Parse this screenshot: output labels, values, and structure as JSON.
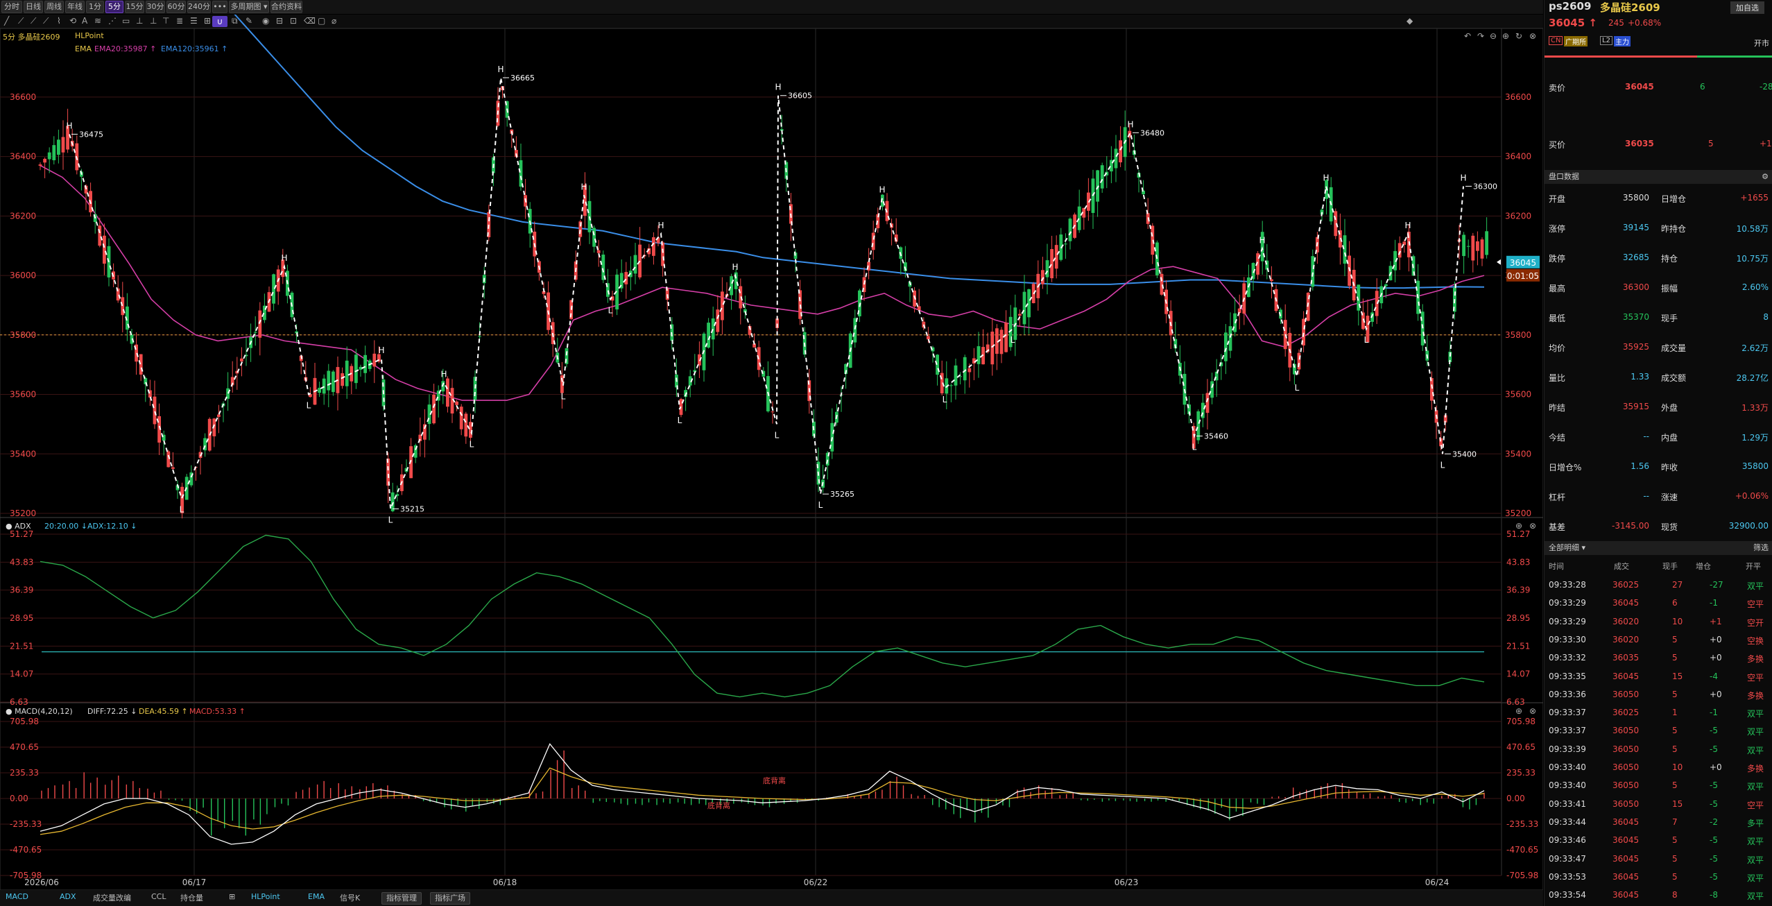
{
  "toolbar": {
    "timeframes": [
      "分时",
      "日线",
      "周线",
      "年线",
      "1分",
      "5分",
      "15分",
      "30分",
      "60分",
      "240分",
      "•••",
      "多周期图 ▾",
      "合约资料"
    ],
    "active_timeframe": "5分"
  },
  "chart_header": {
    "period_symbol": "5分 多晶硅2609",
    "indicator": "HLPoint",
    "ema_label": "EMA",
    "ema20": "EMA20:35987 ↑",
    "ema120": "EMA120:35961 ↑"
  },
  "adx_header": {
    "name": "ADX",
    "v1": "20:20.00 ↓",
    "v2": "ADX:12.10 ↓"
  },
  "macd_header": {
    "name": "MACD(4,20,12)",
    "diff": "DIFF:72.25 ↓",
    "dea": "DEA:45.59 ↑",
    "macd": "MACD:53.33 ↑"
  },
  "colors": {
    "up": "#f04a4a",
    "down": "#25c25a",
    "ema20": "#d63fa8",
    "ema120": "#3a8ee8",
    "adx": "#2aa84a",
    "diff": "#ffffff",
    "dea": "#e8b830",
    "zigzag": "#ffffff"
  },
  "chart_data": [
    {
      "type": "candlestick",
      "title": "多晶硅2609 5分",
      "x_labels": [
        "2026/06",
        "06/17",
        "06/18",
        "06/22",
        "06/23",
        "06/24"
      ],
      "ylim": [
        35200,
        36700
      ],
      "y_ticks": [
        35200,
        35400,
        35600,
        35800,
        36000,
        36200,
        36400,
        36600
      ],
      "reference_line": 35800,
      "current_price": "36045",
      "countdown": "0:01:05",
      "ema20": [
        36370,
        36330,
        36260,
        36150,
        36040,
        35920,
        35850,
        35800,
        35780,
        35790,
        35800,
        35780,
        35770,
        35760,
        35750,
        35700,
        35650,
        35620,
        35600,
        35580,
        35580,
        35580,
        35600,
        35700,
        35850,
        35880,
        35900,
        35930,
        35960,
        35950,
        35940,
        35920,
        35900,
        35890,
        35880,
        35870,
        35890,
        35920,
        35940,
        35900,
        35870,
        35860,
        35880,
        35850,
        35830,
        35820,
        35850,
        35880,
        35920,
        35980,
        36020,
        36030,
        36010,
        35990,
        35900,
        35780,
        35760,
        35800,
        35860,
        35900,
        35920,
        35940,
        35930,
        35950,
        35980,
        36000
      ],
      "ema120": [
        36900,
        36800,
        36700,
        36600,
        36500,
        36420,
        36360,
        36300,
        36250,
        36220,
        36200,
        36180,
        36170,
        36160,
        36150,
        36130,
        36110,
        36100,
        36090,
        36080,
        36060,
        36050,
        36040,
        36030,
        36020,
        36010,
        36000,
        35990,
        35985,
        35980,
        35975,
        35970,
        35970,
        35970,
        35975,
        35980,
        35985,
        35985,
        35980,
        35975,
        35970,
        35965,
        35960,
        35958,
        35958,
        35960,
        35962,
        35961
      ],
      "hl_points": [
        {
          "t": "H",
          "v": 36475,
          "label": "36475"
        },
        {
          "t": "L",
          "v": 35250
        },
        {
          "t": "H",
          "v": 36030
        },
        {
          "t": "L",
          "v": 35600
        },
        {
          "t": "H",
          "v": 35720
        },
        {
          "t": "L",
          "v": 35215,
          "label": "35215"
        },
        {
          "t": "H",
          "v": 35640
        },
        {
          "t": "L",
          "v": 35470
        },
        {
          "t": "H",
          "v": 36665,
          "label": "36665"
        },
        {
          "t": "L",
          "v": 35630
        },
        {
          "t": "H",
          "v": 36270
        },
        {
          "t": "L",
          "v": 35920
        },
        {
          "t": "H",
          "v": 36140
        },
        {
          "t": "L",
          "v": 35550
        },
        {
          "t": "H",
          "v": 36000
        },
        {
          "t": "L",
          "v": 35500
        },
        {
          "t": "H",
          "v": 36605,
          "label": "36605"
        },
        {
          "t": "L",
          "v": 35265,
          "label": "35265"
        },
        {
          "t": "H",
          "v": 36260
        },
        {
          "t": "L",
          "v": 35620
        },
        {
          "t": "L",
          "v": 35820
        },
        {
          "t": "H",
          "v": 36480,
          "label": "36480"
        },
        {
          "t": "L",
          "v": 35460,
          "label": "35460"
        },
        {
          "t": "H",
          "v": 36090
        },
        {
          "t": "L",
          "v": 35660
        },
        {
          "t": "H",
          "v": 36300
        },
        {
          "t": "L",
          "v": 35820
        },
        {
          "t": "H",
          "v": 36140
        },
        {
          "t": "L",
          "v": 35400,
          "label": "35400"
        },
        {
          "t": "H",
          "v": 36300,
          "label": "36300"
        }
      ]
    },
    {
      "type": "line",
      "title": "ADX",
      "ylim": [
        6.63,
        51.27
      ],
      "y_ticks": [
        51.27,
        43.83,
        36.39,
        28.95,
        21.51,
        14.07,
        6.63
      ],
      "reference_value": 20,
      "adx": [
        44,
        43,
        40,
        36,
        32,
        29,
        31,
        36,
        42,
        48,
        51,
        50,
        44,
        34,
        26,
        22,
        21,
        19,
        22,
        27,
        34,
        38,
        41,
        40,
        38,
        35,
        32,
        29,
        22,
        14,
        9,
        8,
        9,
        8,
        9,
        11,
        16,
        20,
        21,
        19,
        17,
        16,
        17,
        18,
        19,
        22,
        26,
        27,
        24,
        22,
        21,
        22,
        22,
        24,
        23,
        20,
        17,
        15,
        14,
        13,
        12,
        11,
        11,
        13,
        12
      ]
    },
    {
      "type": "line+bar",
      "title": "MACD(4,20,12)",
      "ylim": [
        -705.98,
        705.98
      ],
      "y_ticks": [
        705.98,
        470.65,
        235.33,
        0,
        -235.33,
        -470.65,
        -705.98
      ],
      "annotations": [
        "底背离",
        "底背离"
      ],
      "diff": [
        -300,
        -250,
        -150,
        -50,
        0,
        0,
        -50,
        -150,
        -350,
        -420,
        -400,
        -300,
        -150,
        -50,
        0,
        50,
        80,
        50,
        0,
        -50,
        -80,
        -50,
        0,
        50,
        500,
        260,
        120,
        80,
        60,
        40,
        20,
        0,
        -10,
        -20,
        -40,
        -30,
        -20,
        0,
        30,
        80,
        250,
        160,
        40,
        -60,
        -120,
        -60,
        60,
        100,
        80,
        40,
        30,
        20,
        10,
        0,
        -50,
        -100,
        -180,
        -120,
        -60,
        20,
        80,
        120,
        90,
        80,
        30,
        0,
        60,
        -30,
        72
      ],
      "dea": [
        -330,
        -300,
        -230,
        -150,
        -80,
        -40,
        -40,
        -80,
        -180,
        -250,
        -280,
        -260,
        -200,
        -130,
        -70,
        -20,
        20,
        30,
        20,
        0,
        -20,
        -20,
        -10,
        10,
        280,
        200,
        140,
        110,
        90,
        70,
        50,
        30,
        20,
        10,
        0,
        -5,
        -10,
        -5,
        10,
        40,
        150,
        140,
        90,
        30,
        -10,
        -20,
        10,
        40,
        55,
        50,
        45,
        35,
        25,
        15,
        0,
        -30,
        -80,
        -90,
        -70,
        -30,
        10,
        50,
        60,
        65,
        50,
        30,
        40,
        20,
        46
      ],
      "macd": [
        120,
        160,
        240,
        210,
        160,
        90,
        -20,
        -140,
        -340,
        -340,
        -240,
        -80,
        100,
        160,
        140,
        140,
        120,
        40,
        -40,
        -100,
        -120,
        -60,
        20,
        80,
        440,
        120,
        -40,
        -60,
        -60,
        -60,
        -60,
        -60,
        -60,
        -60,
        -80,
        -50,
        -20,
        10,
        40,
        80,
        200,
        40,
        -100,
        -180,
        -220,
        -80,
        100,
        120,
        50,
        -20,
        -30,
        -30,
        -30,
        -30,
        -100,
        -140,
        -200,
        -60,
        20,
        100,
        140,
        140,
        60,
        30,
        -40,
        -60,
        40,
        -100,
        53
      ]
    }
  ],
  "bottom_tabs": [
    "MACD",
    "ADX",
    "成交量改编",
    "CCL",
    "持仓量",
    "HLPoint",
    "EMA",
    "信号K"
  ],
  "bottom_buttons": [
    "指标管理",
    "指标广场"
  ],
  "panel": {
    "symbol": "ps2609",
    "name": "多晶硅2609",
    "add_btn": "加自选",
    "price": "36045 ↑",
    "change": "245",
    "pct": "+0.68%",
    "tags": [
      "CN",
      "广期所",
      "L2",
      "主力"
    ],
    "open_label": "开市",
    "ask_label": "卖价",
    "ask": "36045",
    "ask_vol": "6",
    "ask_chg": "-28",
    "bid_label": "买价",
    "bid": "36035",
    "bid_vol": "5",
    "bid_chg": "+1",
    "section_title": "盘口数据",
    "rows": [
      [
        "开盘",
        "35800",
        "日增仓",
        "+1655"
      ],
      [
        "涨停",
        "39145",
        "昨持仓",
        "10.58万"
      ],
      [
        "跌停",
        "32685",
        "持仓",
        "10.75万"
      ],
      [
        "最高",
        "36300",
        "振幅",
        "2.60%"
      ],
      [
        "最低",
        "35370",
        "现手",
        "8"
      ],
      [
        "均价",
        "35925",
        "成交量",
        "2.62万"
      ],
      [
        "量比",
        "1.33",
        "成交额",
        "28.27亿"
      ],
      [
        "昨结",
        "35915",
        "外盘",
        "1.33万"
      ],
      [
        "今结",
        "--",
        "内盘",
        "1.29万"
      ],
      [
        "日增仓%",
        "1.56",
        "昨收",
        "35800"
      ],
      [
        "杠杆",
        "--",
        "涨速",
        "+0.06%"
      ],
      [
        "基差",
        "-3145.00",
        "现货",
        "32900.00"
      ]
    ],
    "trades_title": "全部明细 ▾",
    "filter": "筛选",
    "trade_headers": [
      "时间",
      "成交",
      "现手",
      "增仓",
      "开平"
    ],
    "trades": [
      [
        "09:33:28",
        "36025",
        "27",
        "-27",
        "双平"
      ],
      [
        "09:33:29",
        "36045",
        "6",
        "-1",
        "空平"
      ],
      [
        "09:33:29",
        "36020",
        "10",
        "+1",
        "空开"
      ],
      [
        "09:33:30",
        "36020",
        "5",
        "+0",
        "空换"
      ],
      [
        "09:33:32",
        "36035",
        "5",
        "+0",
        "多换"
      ],
      [
        "09:33:35",
        "36045",
        "15",
        "-4",
        "空平"
      ],
      [
        "09:33:36",
        "36050",
        "5",
        "+0",
        "多换"
      ],
      [
        "09:33:37",
        "36025",
        "1",
        "-1",
        "双平"
      ],
      [
        "09:33:37",
        "36050",
        "5",
        "-5",
        "双平"
      ],
      [
        "09:33:39",
        "36050",
        "5",
        "-5",
        "双平"
      ],
      [
        "09:33:40",
        "36050",
        "10",
        "+0",
        "多换"
      ],
      [
        "09:33:40",
        "36050",
        "5",
        "-5",
        "双平"
      ],
      [
        "09:33:41",
        "36050",
        "15",
        "-5",
        "空平"
      ],
      [
        "09:33:44",
        "36045",
        "7",
        "-2",
        "多平"
      ],
      [
        "09:33:46",
        "36045",
        "5",
        "-5",
        "双平"
      ],
      [
        "09:33:47",
        "36045",
        "5",
        "-5",
        "双平"
      ],
      [
        "09:33:53",
        "36045",
        "5",
        "-5",
        "双平"
      ],
      [
        "09:33:54",
        "36045",
        "8",
        "-8",
        "双平"
      ]
    ]
  }
}
